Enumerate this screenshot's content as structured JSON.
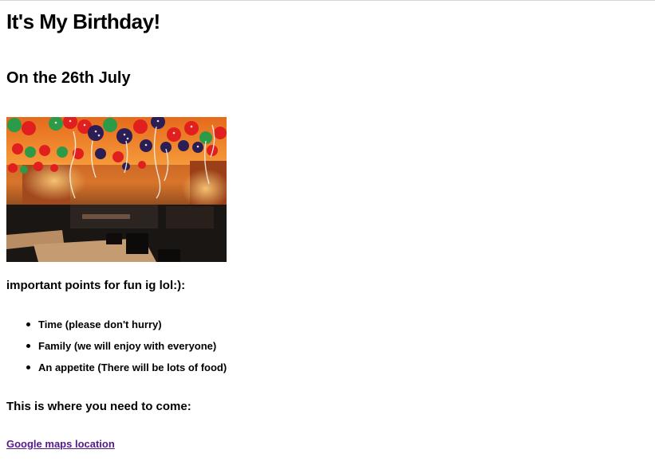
{
  "page": {
    "title": "It's My Birthday!",
    "subtitle": "On the 26th July",
    "photo_alt": "party venue decorated with balloons",
    "points_heading": "important points for fun ig lol:):",
    "points": [
      {
        "label": "Time",
        "note": "(please don't hurry)"
      },
      {
        "label": "Family",
        "note": "(we will enjoy with everyone)"
      },
      {
        "label": "An appetite",
        "note": "(There will be lots of food)"
      }
    ],
    "location_heading": "This is where you need to come:",
    "map_link": "Google maps location"
  },
  "colors": {
    "link_visited": "#551a8b",
    "text": "#000000",
    "background": "#ffffff"
  }
}
